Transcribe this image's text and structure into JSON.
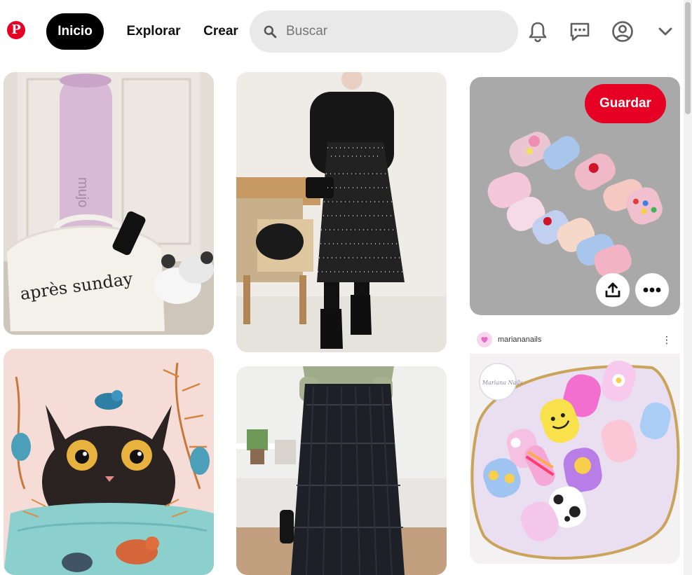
{
  "header": {
    "logo": "P",
    "nav": {
      "home": "Inicio",
      "explore": "Explorar",
      "create": "Crear"
    },
    "search": {
      "placeholder": "Buscar",
      "value": ""
    },
    "icons": [
      "notifications-icon",
      "messages-icon",
      "profile-icon",
      "chevron-down-icon"
    ]
  },
  "pins": {
    "pin1_text": "après sunday",
    "pin1_tag": "mujo",
    "pin5": {
      "save_label": "Guardar",
      "actions": [
        "share-icon",
        "more-options-icon"
      ]
    },
    "pin6": {
      "account": "mariananails",
      "stamp": "Mariana Nails"
    }
  },
  "colors": {
    "brand": "#e60023",
    "search_bg": "#e9e9e9",
    "active_nav": "#000000"
  }
}
